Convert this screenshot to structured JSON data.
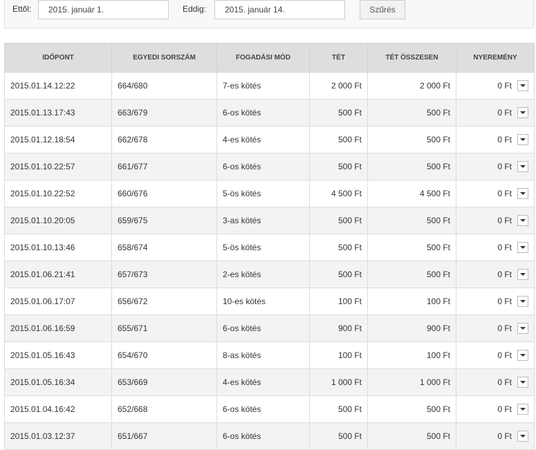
{
  "filter": {
    "from_label": "Ettől:",
    "from_value": "2015. január 1.",
    "to_label": "Eddig:",
    "to_value": "2015. január 14.",
    "button_label": "Szűrés"
  },
  "table": {
    "headers": [
      "IDŐPONT",
      "EGYEDI SORSZÁM",
      "FOGADÁSI MÓD",
      "TÉT",
      "TÉT ÖSSZESEN",
      "NYEREMÉNY"
    ],
    "rows": [
      {
        "time": "2015.01.14.12:22",
        "serial": "664/680",
        "mode": "7-es kötés",
        "stake": "2 000 Ft",
        "total": "2 000 Ft",
        "win": "0 Ft"
      },
      {
        "time": "2015.01.13.17:43",
        "serial": "663/679",
        "mode": "6-os kötés",
        "stake": "500 Ft",
        "total": "500 Ft",
        "win": "0 Ft"
      },
      {
        "time": "2015.01.12.18:54",
        "serial": "662/678",
        "mode": "4-es kötés",
        "stake": "500 Ft",
        "total": "500 Ft",
        "win": "0 Ft"
      },
      {
        "time": "2015.01.10.22:57",
        "serial": "661/677",
        "mode": "6-os kötés",
        "stake": "500 Ft",
        "total": "500 Ft",
        "win": "0 Ft"
      },
      {
        "time": "2015.01.10.22:52",
        "serial": "660/676",
        "mode": "5-ös kötés",
        "stake": "4 500 Ft",
        "total": "4 500 Ft",
        "win": "0 Ft"
      },
      {
        "time": "2015.01.10.20:05",
        "serial": "659/675",
        "mode": "3-as kötés",
        "stake": "500 Ft",
        "total": "500 Ft",
        "win": "0 Ft"
      },
      {
        "time": "2015.01.10.13:46",
        "serial": "658/674",
        "mode": "5-ös kötés",
        "stake": "500 Ft",
        "total": "500 Ft",
        "win": "0 Ft"
      },
      {
        "time": "2015.01.06.21:41",
        "serial": "657/673",
        "mode": "2-es kötés",
        "stake": "500 Ft",
        "total": "500 Ft",
        "win": "0 Ft"
      },
      {
        "time": "2015.01.06.17:07",
        "serial": "656/672",
        "mode": "10-es kötés",
        "stake": "100 Ft",
        "total": "100 Ft",
        "win": "0 Ft"
      },
      {
        "time": "2015.01.06.16:59",
        "serial": "655/671",
        "mode": "6-os kötés",
        "stake": "900 Ft",
        "total": "900 Ft",
        "win": "0 Ft"
      },
      {
        "time": "2015.01.05.16:43",
        "serial": "654/670",
        "mode": "8-as kötés",
        "stake": "100 Ft",
        "total": "100 Ft",
        "win": "0 Ft"
      },
      {
        "time": "2015.01.05.16:34",
        "serial": "653/669",
        "mode": "4-es kötés",
        "stake": "1 000 Ft",
        "total": "1 000 Ft",
        "win": "0 Ft"
      },
      {
        "time": "2015.01.04.16:42",
        "serial": "652/668",
        "mode": "6-os kötés",
        "stake": "500 Ft",
        "total": "500 Ft",
        "win": "0 Ft"
      },
      {
        "time": "2015.01.03.12:37",
        "serial": "651/667",
        "mode": "6-os kötés",
        "stake": "500 Ft",
        "total": "500 Ft",
        "win": "0 Ft"
      }
    ],
    "row_icon": "chevron-down-icon"
  },
  "colors": {
    "header_bg": "#dedede",
    "stripe_bg": "#f3f3f3",
    "filter_bg": "#f8f8f8"
  }
}
